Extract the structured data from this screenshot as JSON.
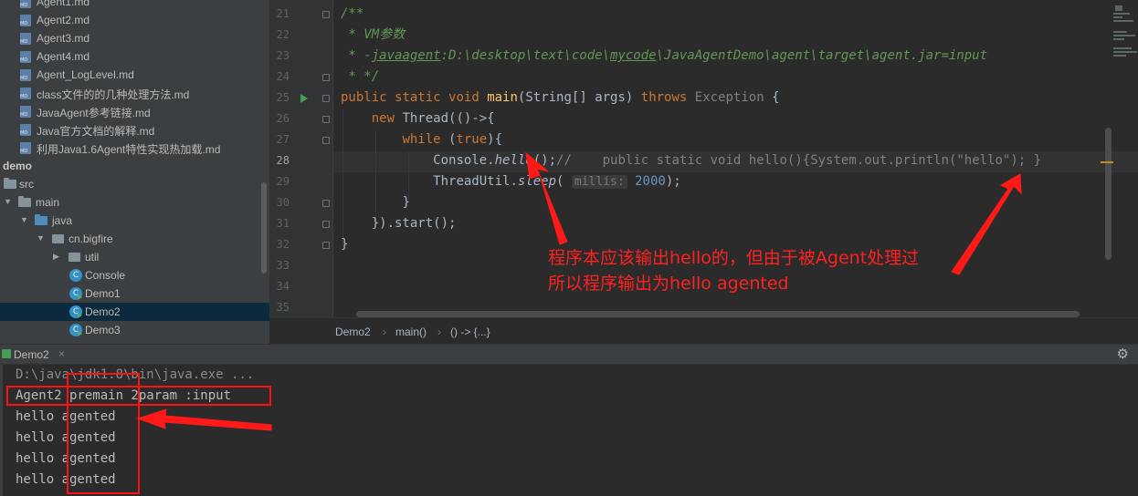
{
  "project_tree": {
    "items": [
      {
        "label": "Agent1.md",
        "kind": "md",
        "indent": 40
      },
      {
        "label": "Agent2.md",
        "kind": "md",
        "indent": 40
      },
      {
        "label": "Agent3.md",
        "kind": "md",
        "indent": 40
      },
      {
        "label": "Agent4.md",
        "kind": "md",
        "indent": 40
      },
      {
        "label": "Agent_LogLevel.md",
        "kind": "md",
        "indent": 40
      },
      {
        "label": "class文件的的几种处理方法.md",
        "kind": "md",
        "indent": 40
      },
      {
        "label": "JavaAgent参考链接.md",
        "kind": "md",
        "indent": 40
      },
      {
        "label": "Java官方文档的解释.md",
        "kind": "md",
        "indent": 40
      },
      {
        "label": "利用Java1.6Agent特性实现热加载.md",
        "kind": "md",
        "indent": 40
      },
      {
        "label": "demo",
        "kind": "module"
      },
      {
        "label": "src",
        "kind": "folder"
      },
      {
        "label": "main",
        "kind": "folder"
      },
      {
        "label": "java",
        "kind": "folder-blue"
      },
      {
        "label": "cn.bigfire",
        "kind": "package"
      },
      {
        "label": "util",
        "kind": "package"
      },
      {
        "label": "Console",
        "kind": "class"
      },
      {
        "label": "Demo1",
        "kind": "class-run"
      },
      {
        "label": "Demo2",
        "kind": "class-run",
        "selected": true
      },
      {
        "label": "Demo3",
        "kind": "class-run"
      }
    ]
  },
  "editor": {
    "line_numbers": [
      "21",
      "22",
      "23",
      "24",
      "25",
      "26",
      "27",
      "28",
      "29",
      "30",
      "31",
      "32",
      "33",
      "34",
      "35"
    ],
    "current_line": "28",
    "code": {
      "l21": "/**",
      "l22": " * VM参数",
      "l23_prefix": " * -",
      "l23_a": "javaagent",
      "l23_b": ":D:\\desktop\\text\\code\\",
      "l23_c": "mycode",
      "l23_d": "\\JavaAgentDemo\\agent\\target\\agent.jar=input",
      "l24": " * */",
      "l25_public": "public",
      "l25_static": "static",
      "l25_void": "void",
      "l25_main": "main",
      "l25_args": "(String[] args) ",
      "l25_throws": "throws",
      "l25_exc": "Exception",
      "l25_brace": " {",
      "l26_new": "new",
      "l26_rest": " Thread(()->{",
      "l27_while": "while",
      "l27_true": "true",
      "l27_rest": "){",
      "l28_console": "Console.",
      "l28_hello": "hello",
      "l28_paren": "();",
      "l28_comment": "//    public static void hello(){System.out.println(\"hello\"); }",
      "l29_thread": "ThreadUtil.",
      "l29_sleep": "sleep",
      "l29_open": "( ",
      "l29_hint": "millis:",
      "l29_val": "2000",
      "l29_close": ");",
      "l30": "}",
      "l31": "}).start();",
      "l32": "}"
    }
  },
  "breadcrumb": {
    "items": [
      "Demo2",
      "main()",
      "() -> {...}"
    ],
    "sep": "›"
  },
  "run_window": {
    "tab_label": "Demo2",
    "tab_close": "×",
    "gear": "⚙",
    "console_lines": [
      "D:\\java\\jdk1.8\\bin\\java.exe ...",
      "Agent2 premain 2param :input",
      "hello agented",
      "hello agented",
      "hello agented",
      "hello agented"
    ]
  },
  "annotation": {
    "line1": "程序本应该输出hello的，但由于被Agent处理过",
    "line2": "所以程序输出为hello  agented",
    "color": "#ff2020"
  },
  "colors": {
    "keyword": "#cc7832",
    "comment": "#629755",
    "method": "#ffc66d",
    "number": "#6897bb",
    "text": "#a9b7c6",
    "annotation": "#ff2020"
  }
}
